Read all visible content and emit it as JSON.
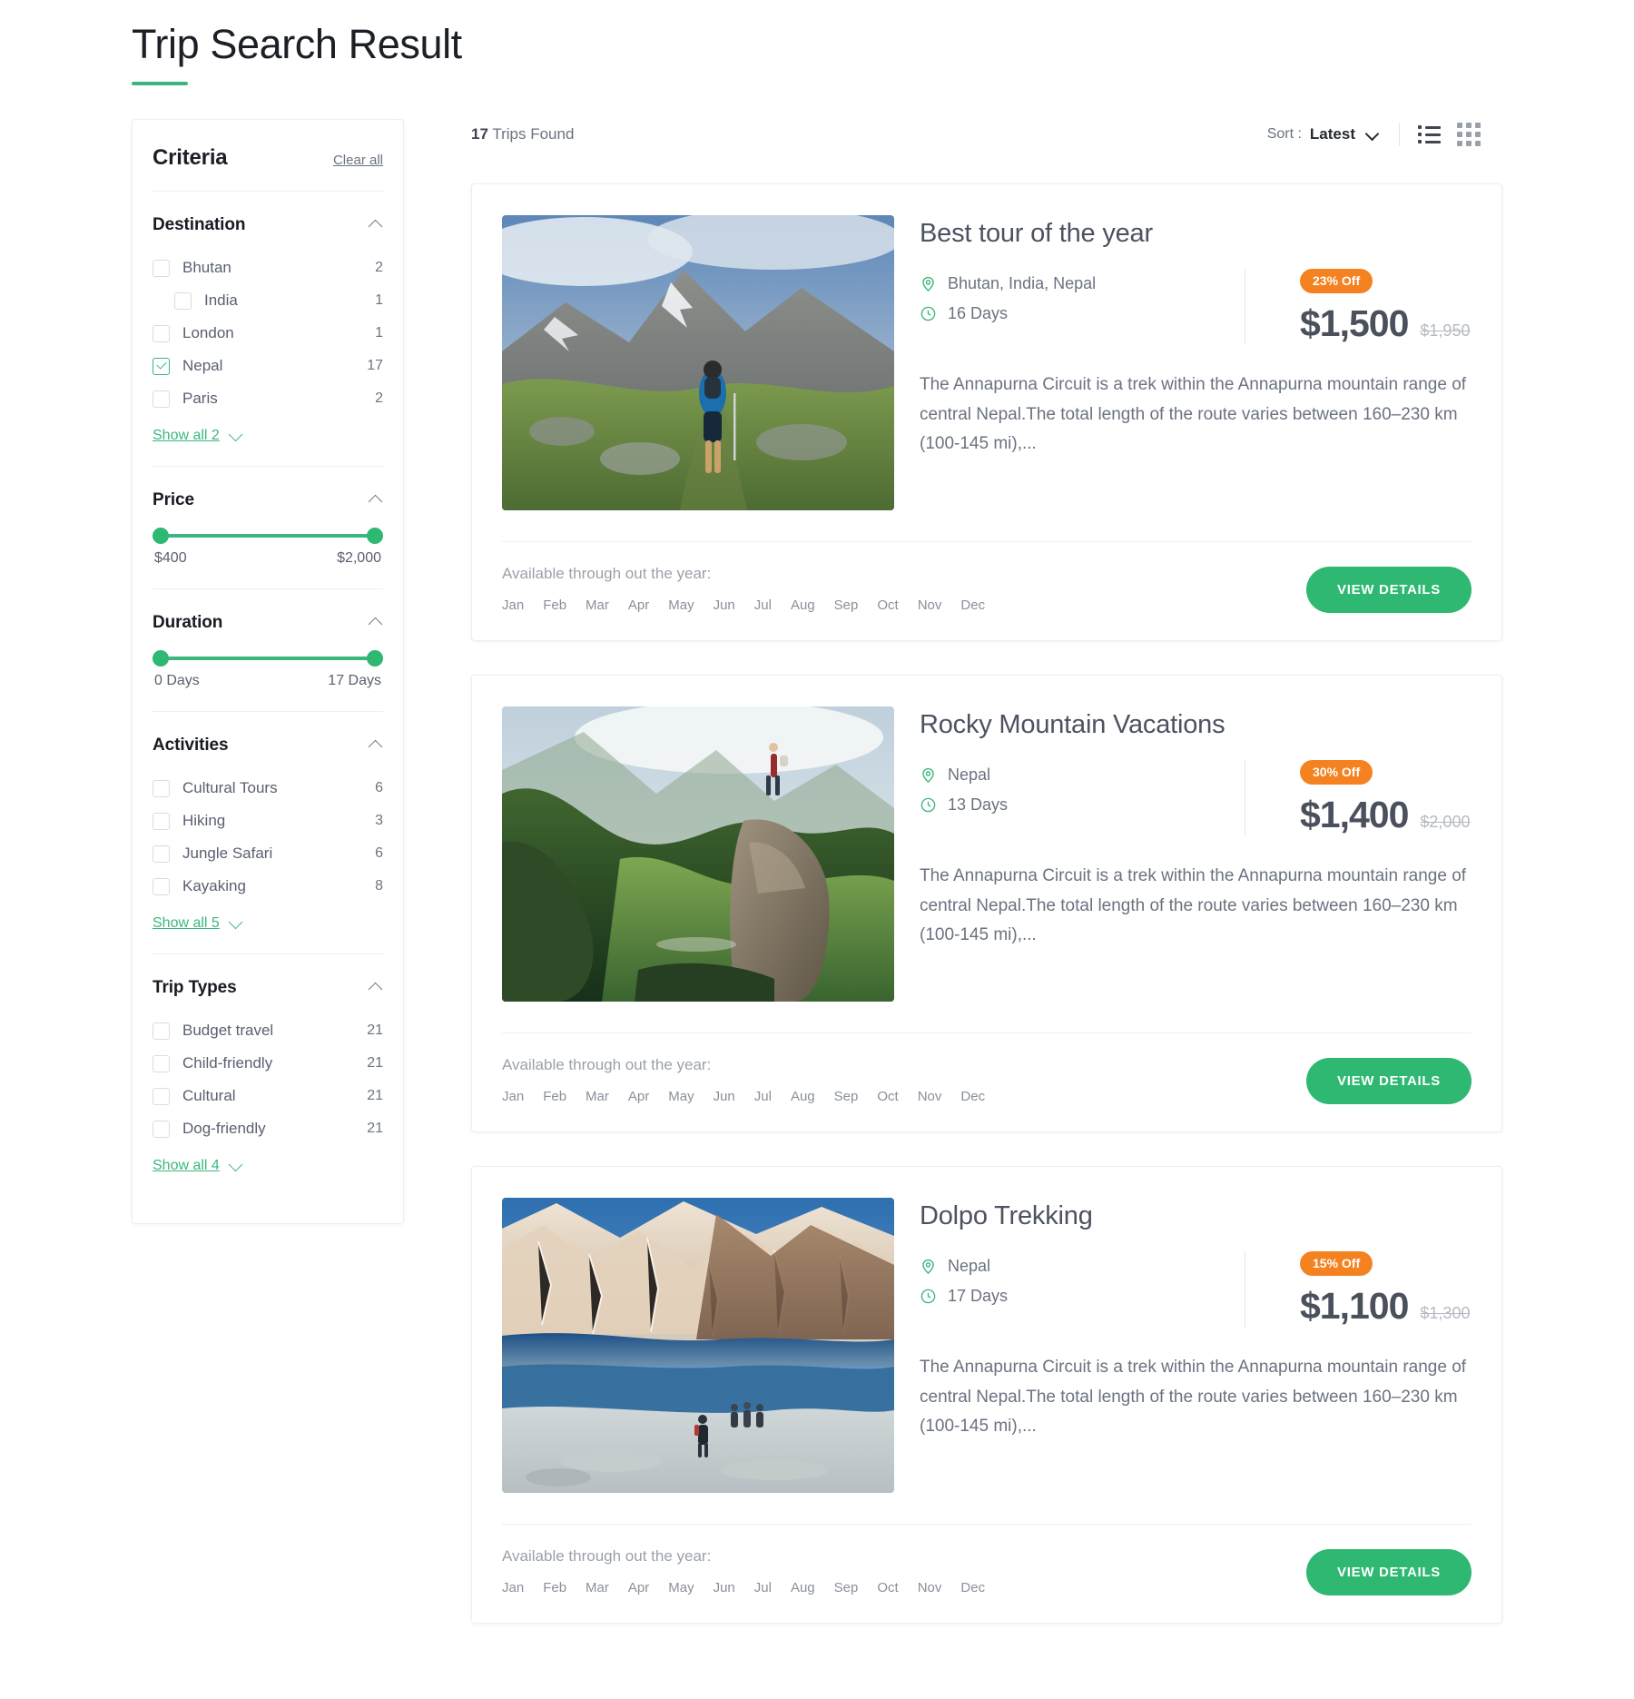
{
  "page": {
    "title": "Trip Search Result",
    "accent_color": "#3bb77e",
    "badge_color": "#f58220",
    "button_color": "#2eb872"
  },
  "sidebar": {
    "title": "Criteria",
    "clear_all": "Clear all",
    "facets": [
      {
        "name": "Destination",
        "collapse_icon": "chevron-up-icon",
        "options": [
          {
            "label": "Bhutan",
            "count": "2",
            "checked": false,
            "indent": false
          },
          {
            "label": "India",
            "count": "1",
            "checked": false,
            "indent": true
          },
          {
            "label": "London",
            "count": "1",
            "checked": false,
            "indent": false
          },
          {
            "label": "Nepal",
            "count": "17",
            "checked": true,
            "indent": false
          },
          {
            "label": "Paris",
            "count": "2",
            "checked": false,
            "indent": false
          }
        ],
        "show_all": "Show all 2"
      },
      {
        "name": "Price",
        "collapse_icon": "chevron-up-icon",
        "slider": {
          "min_label": "$400",
          "max_label": "$2,000"
        }
      },
      {
        "name": "Duration",
        "collapse_icon": "chevron-up-icon",
        "slider": {
          "min_label": "0 Days",
          "max_label": "17 Days"
        }
      },
      {
        "name": "Activities",
        "collapse_icon": "chevron-up-icon",
        "options": [
          {
            "label": "Cultural Tours",
            "count": "6",
            "checked": false,
            "indent": false
          },
          {
            "label": "Hiking",
            "count": "3",
            "checked": false,
            "indent": false
          },
          {
            "label": "Jungle Safari",
            "count": "6",
            "checked": false,
            "indent": false
          },
          {
            "label": "Kayaking",
            "count": "8",
            "checked": false,
            "indent": false
          }
        ],
        "show_all": "Show all 5"
      },
      {
        "name": "Trip Types",
        "collapse_icon": "chevron-up-icon",
        "options": [
          {
            "label": "Budget travel",
            "count": "21",
            "checked": false,
            "indent": false
          },
          {
            "label": "Child-friendly",
            "count": "21",
            "checked": false,
            "indent": false
          },
          {
            "label": "Cultural",
            "count": "21",
            "checked": false,
            "indent": false
          },
          {
            "label": "Dog-friendly",
            "count": "21",
            "checked": false,
            "indent": false
          }
        ],
        "show_all": "Show all 4"
      }
    ]
  },
  "results_bar": {
    "count": "17",
    "found_text": "Trips Found",
    "sort_label": "Sort :",
    "sort_value": "Latest",
    "sort_options": [
      "Latest"
    ],
    "list_view_icon": "list-view-icon",
    "grid_view_icon": "grid-view-icon"
  },
  "cards": [
    {
      "title": "Best tour of the year",
      "location": "Bhutan, India, Nepal",
      "location_icon": "map-pin-icon",
      "duration": "16 Days",
      "duration_icon": "clock-icon",
      "discount": "23% Off",
      "price": "$1,500",
      "price_old": "$1,950",
      "description": "The Annapurna Circuit is a trek within the Annapurna mountain range of central Nepal.The total length of the route varies between 160–230 km (100-145 mi),...",
      "availability_label": "Available through out the year:",
      "months": [
        "Jan",
        "Feb",
        "Mar",
        "Apr",
        "May",
        "Jun",
        "Jul",
        "Aug",
        "Sep",
        "Oct",
        "Nov",
        "Dec"
      ],
      "cta": "VIEW DETAILS",
      "image": "hiker-on-alpine-mountain-trail"
    },
    {
      "title": "Rocky Mountain Vacations",
      "location": "Nepal",
      "location_icon": "map-pin-icon",
      "duration": "13 Days",
      "duration_icon": "clock-icon",
      "discount": "30% Off",
      "price": "$1,400",
      "price_old": "$2,000",
      "description": "The Annapurna Circuit is a trek within the Annapurna mountain range of central Nepal.The total length of the route varies between 160–230 km (100-145 mi),...",
      "availability_label": "Available through out the year:",
      "months": [
        "Jan",
        "Feb",
        "Mar",
        "Apr",
        "May",
        "Jun",
        "Jul",
        "Aug",
        "Sep",
        "Oct",
        "Nov",
        "Dec"
      ],
      "cta": "VIEW DETAILS",
      "image": "green-valley-cliff-viewpoint"
    },
    {
      "title": "Dolpo Trekking",
      "location": "Nepal",
      "location_icon": "map-pin-icon",
      "duration": "17 Days",
      "duration_icon": "clock-icon",
      "discount": "15% Off",
      "price": "$1,100",
      "price_old": "$1,300",
      "description": "The Annapurna Circuit is a trek within the Annapurna mountain range of central Nepal.The total length of the route varies between 160–230 km (100-145 mi),...",
      "availability_label": "Available through out the year:",
      "months": [
        "Jan",
        "Feb",
        "Mar",
        "Apr",
        "May",
        "Jun",
        "Jul",
        "Aug",
        "Sep",
        "Oct",
        "Nov",
        "Dec"
      ],
      "cta": "VIEW DETAILS",
      "image": "trekkers-beside-high-altitude-lake"
    }
  ]
}
